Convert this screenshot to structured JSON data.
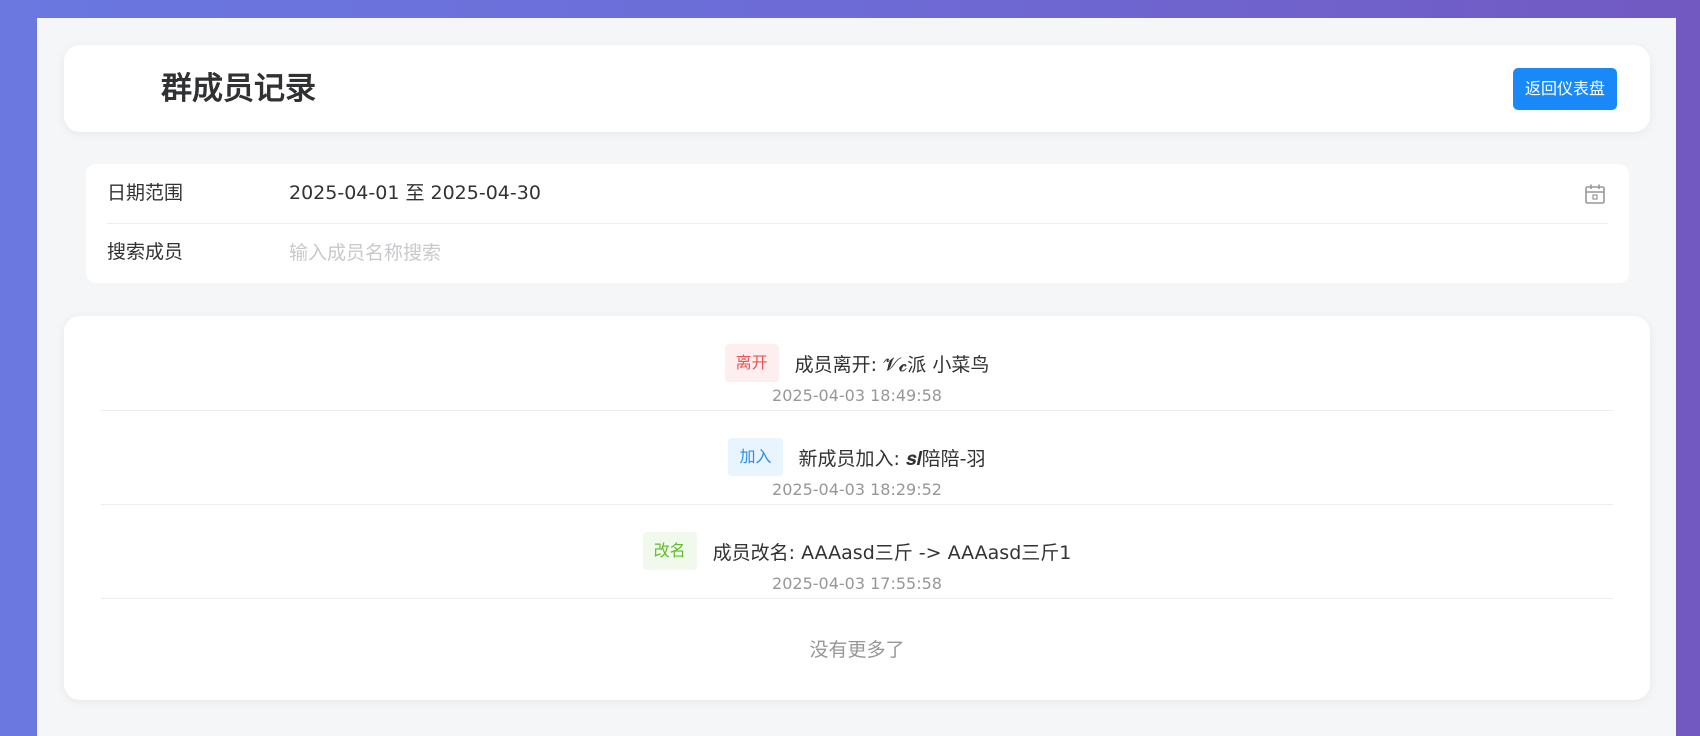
{
  "header": {
    "title": "群成员记录",
    "back_label": "返回仪表盘"
  },
  "filters": {
    "date_label": "日期范围",
    "date_value": "2025-04-01 至 2025-04-30",
    "search_label": "搜索成员",
    "search_placeholder": "输入成员名称搜索",
    "search_value": ""
  },
  "records": [
    {
      "tag": "离开",
      "text": "成员离开: 𝓥𝓬派 小菜鸟",
      "time": "2025-04-03 18:49:58"
    },
    {
      "tag": "加入",
      "text": "新成员加入: 𝒔𝒍陪陪-羽",
      "time": "2025-04-03 18:29:52"
    },
    {
      "tag": "改名",
      "text": "成员改名: AAAasd三斤 -> AAAasd三斤1",
      "time": "2025-04-03 17:55:58"
    }
  ],
  "list_footer": "没有更多了",
  "colors": {
    "primary": "#1989fa",
    "leave_tag": "#e85353",
    "join_tag": "#2a8ee8",
    "rename_tag": "#5fbd2c"
  },
  "icons": {
    "date_picker": "calendar-icon"
  }
}
